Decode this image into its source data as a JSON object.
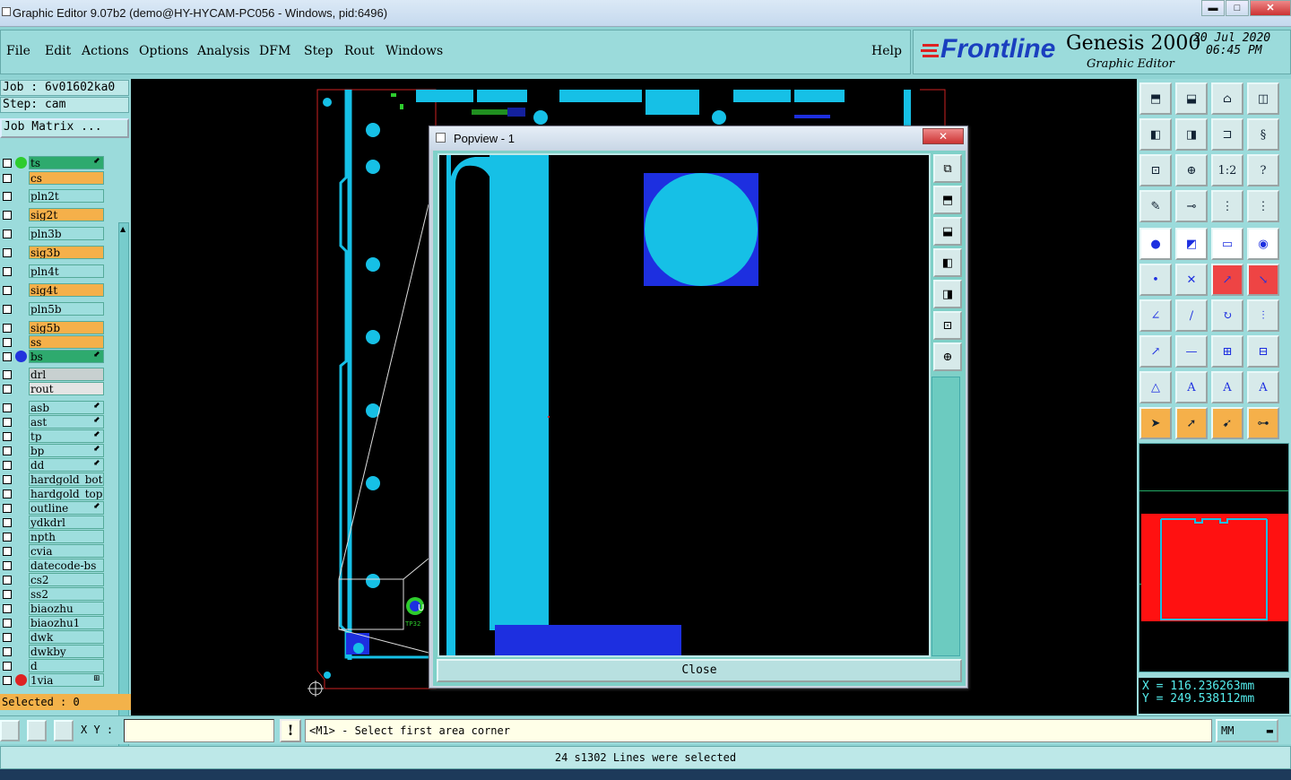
{
  "window": {
    "title": "Graphic Editor 9.07b2 (demo@HY-HYCAM-PC056 - Windows, pid:6496)",
    "min": "▬",
    "max": "□",
    "close": "✕"
  },
  "menu": {
    "file": "File",
    "edit": "Edit",
    "actions": "Actions",
    "options": "Options",
    "analysis": "Analysis",
    "dfm": "DFM",
    "step": "Step",
    "rout": "Rout",
    "windows": "Windows",
    "help": "Help"
  },
  "brand": {
    "logo": "Frontline",
    "product": "Genesis 2000",
    "subtitle": "Graphic Editor",
    "date": "20 Jul 2020",
    "time": "06:45 PM"
  },
  "job": {
    "job_line": "Job : 6v01602ka0",
    "step_line": "Step: cam",
    "matrix_button": "Job Matrix ..."
  },
  "layers": [
    {
      "name": "ts",
      "color": "#2eaa6e",
      "dot": "#2ecc2e",
      "mark": "⬋"
    },
    {
      "name": "cs",
      "color": "#f5b04a",
      "dot": "",
      "mark": ""
    },
    {
      "name": "pln2t",
      "color": "#9edede",
      "dot": "",
      "mark": ""
    },
    {
      "name": "sig2t",
      "color": "#f5b04a",
      "dot": "",
      "mark": ""
    },
    {
      "name": "pln3b",
      "color": "#9edede",
      "dot": "",
      "mark": ""
    },
    {
      "name": "sig3b",
      "color": "#f5b04a",
      "dot": "",
      "mark": ""
    },
    {
      "name": "pln4t",
      "color": "#9edede",
      "dot": "",
      "mark": ""
    },
    {
      "name": "sig4t",
      "color": "#f5b04a",
      "dot": "",
      "mark": ""
    },
    {
      "name": "pln5b",
      "color": "#9edede",
      "dot": "",
      "mark": ""
    },
    {
      "name": "sig5b",
      "color": "#f5b04a",
      "dot": "",
      "mark": ""
    },
    {
      "name": "ss",
      "color": "#f5b04a",
      "dot": "",
      "mark": ""
    },
    {
      "name": "bs",
      "color": "#2eaa6e",
      "dot": "#2233dd",
      "mark": "⬋"
    },
    {
      "name": "drl",
      "color": "#c8d0d0",
      "dot": "",
      "mark": ""
    },
    {
      "name": "rout",
      "color": "#e4e4e4",
      "dot": "",
      "mark": ""
    },
    {
      "name": "asb",
      "color": "#9edede",
      "dot": "",
      "mark": "⬋"
    },
    {
      "name": "ast",
      "color": "#9edede",
      "dot": "",
      "mark": "⬋"
    },
    {
      "name": "tp",
      "color": "#9edede",
      "dot": "",
      "mark": "⬋"
    },
    {
      "name": "bp",
      "color": "#9edede",
      "dot": "",
      "mark": "⬋"
    },
    {
      "name": "dd",
      "color": "#9edede",
      "dot": "",
      "mark": "⬋"
    },
    {
      "name": "hardgold_bot",
      "color": "#9edede",
      "dot": "",
      "mark": ""
    },
    {
      "name": "hardgold_top",
      "color": "#9edede",
      "dot": "",
      "mark": ""
    },
    {
      "name": "outline",
      "color": "#9edede",
      "dot": "",
      "mark": "⬋"
    },
    {
      "name": "ydkdrl",
      "color": "#9edede",
      "dot": "",
      "mark": ""
    },
    {
      "name": "npth",
      "color": "#9edede",
      "dot": "",
      "mark": ""
    },
    {
      "name": "cvia",
      "color": "#9edede",
      "dot": "",
      "mark": ""
    },
    {
      "name": "datecode-bs",
      "color": "#9edede",
      "dot": "",
      "mark": ""
    },
    {
      "name": "cs2",
      "color": "#9edede",
      "dot": "",
      "mark": ""
    },
    {
      "name": "ss2",
      "color": "#9edede",
      "dot": "",
      "mark": ""
    },
    {
      "name": "biaozhu",
      "color": "#9edede",
      "dot": "",
      "mark": ""
    },
    {
      "name": "biaozhu1",
      "color": "#9edede",
      "dot": "",
      "mark": ""
    },
    {
      "name": "dwk",
      "color": "#9edede",
      "dot": "",
      "mark": ""
    },
    {
      "name": "dwkby",
      "color": "#9edede",
      "dot": "",
      "mark": ""
    },
    {
      "name": "d",
      "color": "#9edede",
      "dot": "",
      "mark": ""
    },
    {
      "name": "1via",
      "color": "#9edede",
      "dot": "#dd2222",
      "mark": "⊞"
    }
  ],
  "selected_count": "Selected : 0",
  "popview": {
    "title": "Popview - 1",
    "close_label": "Close",
    "close_x": "✕"
  },
  "pcb_labels": {
    "ref_u": "U",
    "ref_tp": "TP32"
  },
  "coords": {
    "x": "X = 116.236263mm",
    "y": "Y = 249.538112mm"
  },
  "bottom": {
    "xy_label": "X Y :",
    "xy_value": "",
    "prompt": "<M1> - Select first area corner",
    "units": "MM"
  },
  "status_message": "24 s1302 Lines were selected",
  "colors": {
    "copper": "#16c0e6",
    "pad_blue": "#1d2fe0",
    "outline_red": "#cc2222",
    "minimap_fill": "#ff1111"
  },
  "icons": {
    "toolbar": [
      "zoom-home-icon",
      "zoom-in-icon",
      "zoom-window-icon",
      "zoom-out-icon",
      "pan-left-icon",
      "pan-right-icon",
      "pan-center-icon",
      "pan-s-icon",
      "fit-all-icon",
      "fit-profile-icon",
      "zoom-1to1-icon",
      "help-query-icon",
      "measure-tool-icon",
      "snap-icon",
      "layer-select-icon",
      "layer-compare-icon",
      "filter-pad-icon",
      "filter-surface-icon",
      "ruler-icon",
      "highlight-pad-icon",
      "add-feature-icon",
      "delete-feature-icon",
      "move-feature-icon",
      "copy-feature-icon",
      "angle-icon",
      "slope-icon",
      "rotate-icon",
      "mirror-icon",
      "resize-icon",
      "line-icon",
      "symbol-icon",
      "connect-icon",
      "triangle-a-icon",
      "triangle-b-icon",
      "triangle-c-icon",
      "triangle-d-icon",
      "select-arrow-icon",
      "select-box-icon",
      "select-single-icon",
      "select-net-icon"
    ],
    "popview_tools": [
      "pv-zoom-window-icon",
      "pv-zoom-in-icon",
      "pv-zoom-out-icon",
      "pv-pan-left-icon",
      "pv-pan-right-icon",
      "pv-fit-icon",
      "pv-center-icon"
    ]
  }
}
